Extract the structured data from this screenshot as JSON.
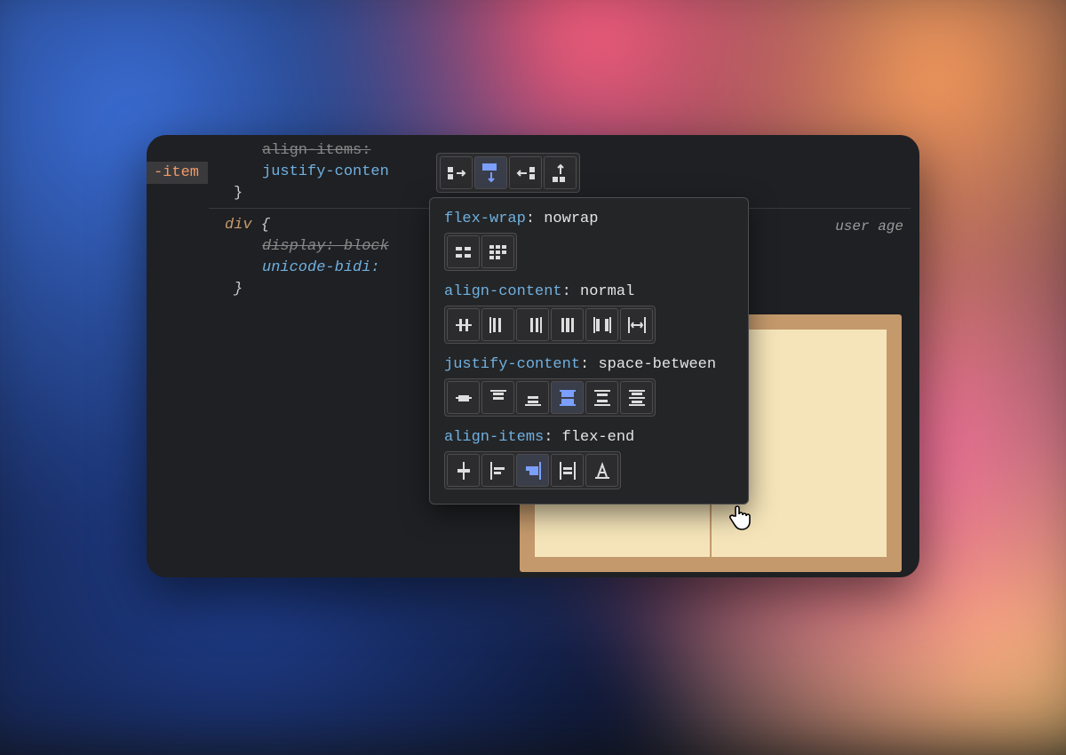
{
  "code": {
    "ghost_line": "align-items:",
    "prop_line": "justify-conten",
    "brace1": "}",
    "sel_div": "div",
    "brace_open": " {",
    "display_block": "display: block",
    "unicode_bidi": "unicode-bidi:",
    "brace2": "}"
  },
  "badge": "-item",
  "user_agent_label": "user age",
  "flex_direction": {
    "options": [
      "row",
      "column",
      "row-reverse",
      "column-reverse"
    ],
    "selected": "column"
  },
  "sections": {
    "flex_wrap": {
      "label": "flex-wrap",
      "value": "nowrap"
    },
    "align_content": {
      "label": "align-content",
      "value": "normal"
    },
    "justify_content": {
      "label": "justify-content",
      "value": "space-between",
      "selected_index": 3
    },
    "align_items": {
      "label": "align-items",
      "value": "flex-end",
      "selected_index": 2
    }
  }
}
